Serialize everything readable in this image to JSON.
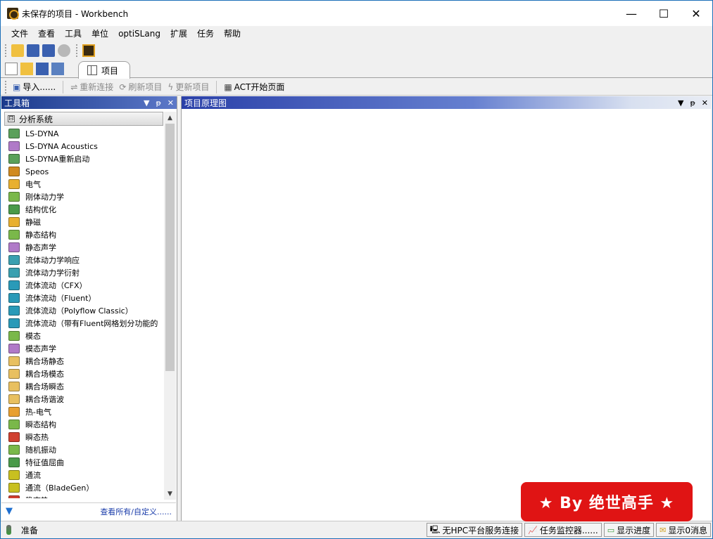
{
  "window": {
    "title": "未保存的项目 - Workbench",
    "controls": {
      "minimize": "—",
      "maximize": "☐",
      "close": "✕"
    }
  },
  "menu": [
    "文件",
    "查看",
    "工具",
    "单位",
    "optiSLang",
    "扩展",
    "任务",
    "帮助"
  ],
  "tabs": {
    "active_label": "项目"
  },
  "toolbar2": {
    "import": "导入......",
    "reconnect": "重新连接",
    "refresh": "刷新项目",
    "update": "更新项目",
    "act": "ACT开始页面"
  },
  "toolbox": {
    "title": "工具箱",
    "group_title": "分析系统",
    "group_toggle": "⊟",
    "items": [
      {
        "label": "LS-DYNA",
        "color": "#5aa05a"
      },
      {
        "label": "LS-DYNA Acoustics",
        "color": "#b07ac8"
      },
      {
        "label": "LS-DYNA重新启动",
        "color": "#5aa05a"
      },
      {
        "label": "Speos",
        "color": "#d08a20"
      },
      {
        "label": "电气",
        "color": "#e8b030"
      },
      {
        "label": "刚体动力学",
        "color": "#7ab84a"
      },
      {
        "label": "结构优化",
        "color": "#4a9a4a"
      },
      {
        "label": "静磁",
        "color": "#e8b030"
      },
      {
        "label": "静态结构",
        "color": "#7ab84a"
      },
      {
        "label": "静态声学",
        "color": "#b07ac8"
      },
      {
        "label": "流体动力学响应",
        "color": "#3aa0b0"
      },
      {
        "label": "流体动力学衍射",
        "color": "#3aa0b0"
      },
      {
        "label": "流体流动（CFX）",
        "color": "#2a9ab8"
      },
      {
        "label": "流体流动（Fluent）",
        "color": "#2a9ab8"
      },
      {
        "label": "流体流动（Polyflow Classic）",
        "color": "#2a9ab8"
      },
      {
        "label": "流体流动（带有Fluent网格划分功能的",
        "color": "#2a9ab8"
      },
      {
        "label": "模态",
        "color": "#7ab84a"
      },
      {
        "label": "模态声学",
        "color": "#b07ac8"
      },
      {
        "label": "耦合场静态",
        "color": "#e8c060"
      },
      {
        "label": "耦合场模态",
        "color": "#e8c060"
      },
      {
        "label": "耦合场瞬态",
        "color": "#e8c060"
      },
      {
        "label": "耦合场谐波",
        "color": "#e8c060"
      },
      {
        "label": "热-电气",
        "color": "#e8a030"
      },
      {
        "label": "瞬态结构",
        "color": "#7ab84a"
      },
      {
        "label": "瞬态热",
        "color": "#d04030"
      },
      {
        "label": "随机振动",
        "color": "#7ab84a"
      },
      {
        "label": "特征值屈曲",
        "color": "#4a9a4a"
      },
      {
        "label": "通流",
        "color": "#c8c020"
      },
      {
        "label": "通流（BladeGen）",
        "color": "#c8c020"
      },
      {
        "label": "稳态热",
        "color": "#d04030"
      }
    ],
    "footer_link": "查看所有/自定义......"
  },
  "schematic": {
    "title": "项目原理图"
  },
  "panel_controls": {
    "dropdown": "▼",
    "pin": "ᵽ",
    "close": "✕"
  },
  "status": {
    "ready": "准备",
    "hpc": "无HPC平台服务连接",
    "monitor": "任务监控器......",
    "progress": "显示进度",
    "messages": "显示0消息"
  },
  "watermark": "★ By 绝世高手 ★"
}
